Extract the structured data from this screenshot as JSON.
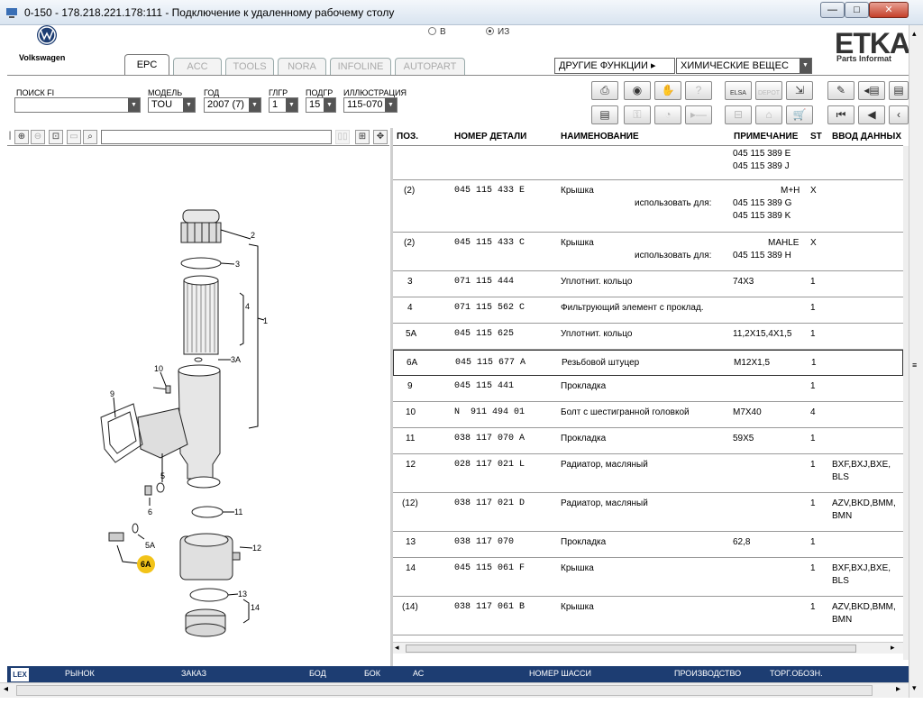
{
  "window": {
    "title": "0-150 - 178.218.221.178:111 - Подключение к удаленному рабочему столу",
    "minimize": "—",
    "maximize": "□",
    "close": "✕"
  },
  "app": {
    "brand": "Volkswagen",
    "radio_in": "В",
    "radio_out": "ИЗ",
    "etka_logo": "ETKA",
    "etka_sub": "Parts Informat",
    "tabs": [
      "EPC",
      "ACC",
      "TOOLS",
      "NORA",
      "INFOLINE",
      "AUTOPART"
    ],
    "other_functions": "ДРУГИЕ ФУНКЦИИ ▸",
    "chemicals": "ХИМИЧЕСКИЕ ВЕЩЕС"
  },
  "filters": {
    "search_label": "ПОИСК FI",
    "search_value": "",
    "model_label": "МОДЕЛЬ",
    "model_value": "TOU",
    "year_label": "ГОД",
    "year_value": "2007 (7)",
    "mg_label": "ГЛГР",
    "mg_value": "1",
    "sg_label": "ПОДГР",
    "sg_value": "15",
    "illus_label": "ИЛЛЮСТРАЦИЯ",
    "illus_value": "115-070"
  },
  "toolbar": {
    "elsa": "ELSA",
    "depot": "DEPOT"
  },
  "diagram_labels": [
    "2",
    "3",
    "4",
    "1",
    "3A",
    "10",
    "9",
    "5",
    "6",
    "11",
    "5A",
    "6A",
    "12",
    "13",
    "14"
  ],
  "grid": {
    "headers": {
      "pos": "ПОЗ.",
      "part": "НОМЕР ДЕТАЛИ",
      "name": "НАИМЕНОВАНИЕ",
      "note": "ПРИМЕЧАНИЕ",
      "st": "ST",
      "input": "ВВОД ДАННЫХ"
    },
    "top_notes": [
      "045 115 389 E",
      "045 115 389 J"
    ],
    "rows": [
      {
        "pos": "(2)",
        "part": "045 115 433 E",
        "name": "Крышка",
        "use_for": "использовать для:",
        "note_right": "M+H",
        "notes": [
          "045 115 389 G",
          "045 115 389 K"
        ],
        "st": "X",
        "input": ""
      },
      {
        "pos": "(2)",
        "part": "045 115 433 C",
        "name": "Крышка",
        "use_for": "использовать для:",
        "note_right": "MAHLE",
        "notes": [
          "045 115 389 H"
        ],
        "st": "X",
        "input": ""
      },
      {
        "pos": "3",
        "part": "071 115 444",
        "name": "Уплотнит. кольцо",
        "note": "74X3",
        "st": "1",
        "input": ""
      },
      {
        "pos": "4",
        "part": "071 115 562 C",
        "name": "Фильтрующий элемент с проклад.",
        "note": "",
        "st": "1",
        "input": ""
      },
      {
        "pos": "5A",
        "part": "045 115 625",
        "name": "Уплотнит. кольцо",
        "note": "11,2X15,4X1,5",
        "st": "1",
        "input": ""
      },
      {
        "pos": "6A",
        "part": "045 115 677 A",
        "name": "Резьбовой штуцер",
        "note": "M12X1,5",
        "st": "1",
        "input": ""
      },
      {
        "pos": "9",
        "part": "045 115 441",
        "name": "Прокладка",
        "note": "",
        "st": "1",
        "input": ""
      },
      {
        "pos": "10",
        "part": "N  911 494 01",
        "name": "Болт с шестигранной головкой",
        "note": "M7X40",
        "st": "4",
        "input": ""
      },
      {
        "pos": "11",
        "part": "038 117 070 A",
        "name": "Прокладка",
        "note": "59X5",
        "st": "1",
        "input": ""
      },
      {
        "pos": "12",
        "part": "028 117 021 L",
        "name": "Радиатор, масляный",
        "note": "",
        "st": "1",
        "input": "BXF,BXJ,BXE,",
        "input2": "BLS"
      },
      {
        "pos": "(12)",
        "part": "038 117 021 D",
        "name": "Радиатор, масляный",
        "note": "",
        "st": "1",
        "input": "AZV,BKD,BMM,",
        "input2": "BMN"
      },
      {
        "pos": "13",
        "part": "038 117 070",
        "name": "Прокладка",
        "note": "62,8",
        "st": "1",
        "input": ""
      },
      {
        "pos": "14",
        "part": "045 115 061 F",
        "name": "Крышка",
        "note": "",
        "st": "1",
        "input": "BXF,BXJ,BXE,",
        "input2": "BLS"
      },
      {
        "pos": "(14)",
        "part": "038 117 061 B",
        "name": "Крышка",
        "note": "",
        "st": "1",
        "input": "AZV,BKD,BMM,",
        "input2": "BMN"
      }
    ]
  },
  "status": {
    "lex": "LEX",
    "market": "РЫНОК",
    "order": "ЗАКАЗ",
    "bod": "БОД",
    "bok": "БОК",
    "ac": "АС",
    "vin": "НОМЕР ШАССИ",
    "production": "ПРОИЗВОДСТВО",
    "trade": "ТОРГ.ОБОЗН."
  },
  "colors": {
    "status_bg": "#1d3d72",
    "highlight": "#f2c318"
  }
}
